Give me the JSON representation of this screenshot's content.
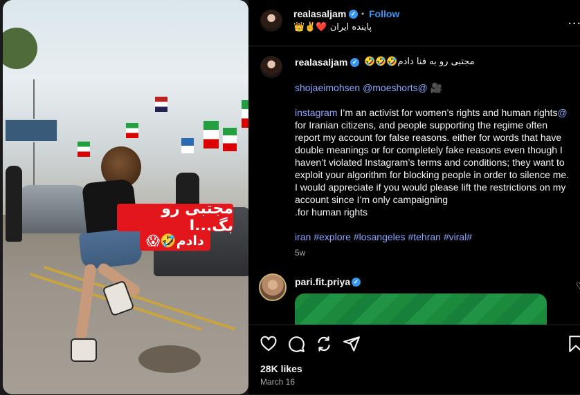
{
  "post": {
    "username": "realasaljam",
    "follow_label": "Follow",
    "dot": "•",
    "bio_line": "پاینده ایران ❤️✌️👑",
    "more_label": "...",
    "video_caption_line1": "مجتبی رو بگ...ا",
    "video_caption_line2": "دادم🤣😱"
  },
  "caption": {
    "username": "realasaljam",
    "title_rtl": "مجتبی رو به فنا دادم🤣🤣🤣",
    "credits": "shojaeimohsen @moeshorts@ 🎥",
    "body_link": "instagram",
    "body_text": " I’m an activist for women’s rights and human rights",
    "body_at": "@",
    "body_rest": "for Iranian citizens, and people supporting the regime often report my account for false reasons. either for words that have double meanings or for completely fake reasons even though I haven’t violated Instagram’s terms and conditions; they want to exploit your algorithm for blocking people in order to silence me. I would appreciate if you would please lift the restrictions on my account since I’m only campaigning",
    "body_end": ".for human rights",
    "hashtags": "iran #explore #losangeles #tehran #viral#",
    "time_ago": "5w"
  },
  "comment": {
    "username": "pari.fit.priya"
  },
  "footer": {
    "likes": "28K likes",
    "date": "March 16"
  },
  "icons": [
    "heart-icon",
    "comment-icon",
    "share-icon",
    "send-icon",
    "bookmark-icon",
    "verified-badge-icon",
    "more-icon"
  ],
  "colors": {
    "accent": "#3797f0",
    "link": "#8fa7ff",
    "caption_bg": "#e3161b",
    "panel_bg": "#000000"
  }
}
